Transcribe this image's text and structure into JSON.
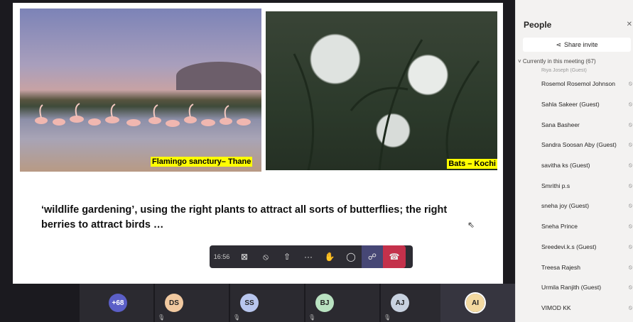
{
  "slide": {
    "caption_left": "Flamingo sanctury– Thane",
    "caption_right": "Bats – Kochi",
    "text": "‘wildlife gardening’, using the right plants to attract all sorts of butterflies; the right berries to attract birds …"
  },
  "toolbar": {
    "time": "16:56",
    "buttons": [
      "camera-off-icon",
      "mic-off-icon",
      "share-screen-icon",
      "more-icon",
      "raise-hand-icon",
      "chat-icon",
      "people-icon",
      "leave-icon"
    ]
  },
  "strip": {
    "overflow": "+68",
    "participants": [
      {
        "initials": "DS",
        "color": "#f1c9a0"
      },
      {
        "initials": "SS",
        "color": "#b8c6ee"
      },
      {
        "initials": "BJ",
        "color": "#b9e2c1"
      },
      {
        "initials": "AJ",
        "color": "#c8d2e0"
      },
      {
        "initials": "AI",
        "color": "#f3d9a0"
      }
    ]
  },
  "panel": {
    "title": "People",
    "share": "Share invite",
    "section": "Currently in this meeting (67)",
    "cut_top": "Riya Joseph (Guest)",
    "people": [
      "Rosemol Rosemol Johnson",
      "Sahla Sakeer (Guest)",
      "Sana Basheer",
      "Sandra Soosan Aby (Guest)",
      "savitha ks (Guest)",
      "Smrithi p.s",
      "sneha joy (Guest)",
      "Sneha Prince",
      "Sreedevi.k.s (Guest)",
      "Treesa Rajesh",
      "Urmila Ranjith (Guest)",
      "VIMOD KK"
    ]
  }
}
